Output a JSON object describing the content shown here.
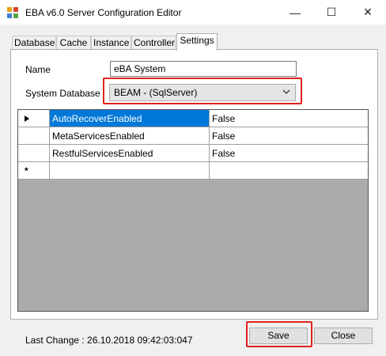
{
  "window": {
    "title": "EBA v6.0 Server Configuration Editor",
    "minimize_glyph": "—",
    "maximize_glyph": "☐",
    "close_glyph": "✕"
  },
  "tabs": [
    {
      "label": "Database",
      "active": false
    },
    {
      "label": "Cache",
      "active": false
    },
    {
      "label": "Instance",
      "active": false
    },
    {
      "label": "Controller",
      "active": false
    },
    {
      "label": "Settings",
      "active": true
    }
  ],
  "form": {
    "name_label": "Name",
    "name_value": "eBA System",
    "system_database_label": "System Database",
    "system_database_value": "BEAM - (SqlServer)"
  },
  "grid": {
    "rows": [
      {
        "key": "AutoRecoverEnabled",
        "value": "False",
        "current": true
      },
      {
        "key": "MetaServicesEnabled",
        "value": "False",
        "current": false
      },
      {
        "key": "RestfulServicesEnabled",
        "value": "False",
        "current": false
      }
    ],
    "new_row_marker": "*"
  },
  "footer": {
    "last_change": "Last Change : 26.10.2018 09:42:03:047",
    "save_label": "Save",
    "close_label": "Close"
  },
  "colors": {
    "highlight_frame": "#e0201f",
    "selection": "#0078d7",
    "grid_background": "#ababab"
  }
}
